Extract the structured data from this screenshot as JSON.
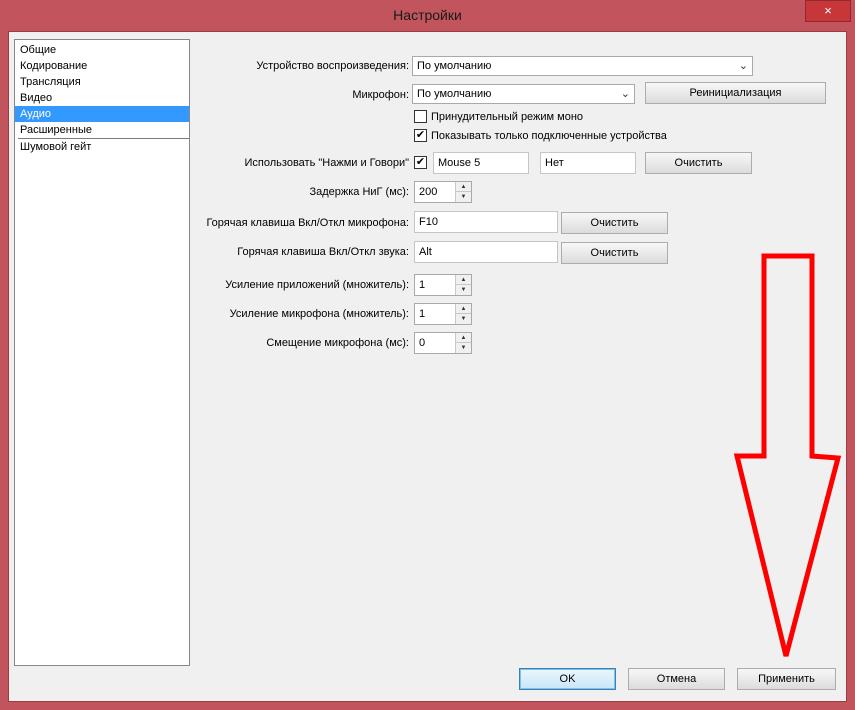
{
  "window": {
    "title": "Настройки",
    "close_icon": "×"
  },
  "nav": {
    "items": [
      {
        "label": "Общие"
      },
      {
        "label": "Кодирование"
      },
      {
        "label": "Трансляция"
      },
      {
        "label": "Видео"
      },
      {
        "label": "Аудио",
        "selected": true
      },
      {
        "label": "Расширенные"
      },
      {
        "label": "Шумовой гейт"
      }
    ]
  },
  "audio": {
    "playback_device": {
      "label": "Устройство воспроизведения:",
      "value": "По умолчанию"
    },
    "microphone": {
      "label": "Микрофон:",
      "value": "По умолчанию"
    },
    "reinit_button": "Реинициализация",
    "force_mono": {
      "label": "Принудительный режим моно",
      "checked": false
    },
    "show_connected": {
      "label": "Показывать только подключенные устройства",
      "checked": true
    },
    "push_to_talk": {
      "label": "Использовать \"Нажми и Говори\"",
      "checked": true,
      "hotkey1": "Mouse 5",
      "hotkey2": "Нет",
      "clear": "Очистить"
    },
    "ptt_delay": {
      "label": "Задержка НиГ (мс):",
      "value": "200"
    },
    "mic_hotkey": {
      "label": "Горячая клавиша Вкл/Откл микрофона:",
      "value": "F10",
      "clear": "Очистить"
    },
    "sound_hotkey": {
      "label": "Горячая клавиша Вкл/Откл звука:",
      "value": "Alt",
      "clear": "Очистить"
    },
    "app_gain": {
      "label": "Усиление приложений (множитель):",
      "value": "1"
    },
    "mic_gain": {
      "label": "Усиление микрофона (множитель):",
      "value": "1"
    },
    "mic_offset": {
      "label": "Смещение микрофона (мс):",
      "value": "0"
    }
  },
  "footer": {
    "ok": "OK",
    "cancel": "Отмена",
    "apply": "Применить"
  },
  "icons": {
    "dropdown": "chevron-down-icon",
    "check": "✔",
    "spin_up": "▲",
    "spin_down": "▼"
  },
  "colors": {
    "window_frame": "#c1545c",
    "selection": "#3399ff",
    "annotation_arrow": "#ff0000"
  }
}
